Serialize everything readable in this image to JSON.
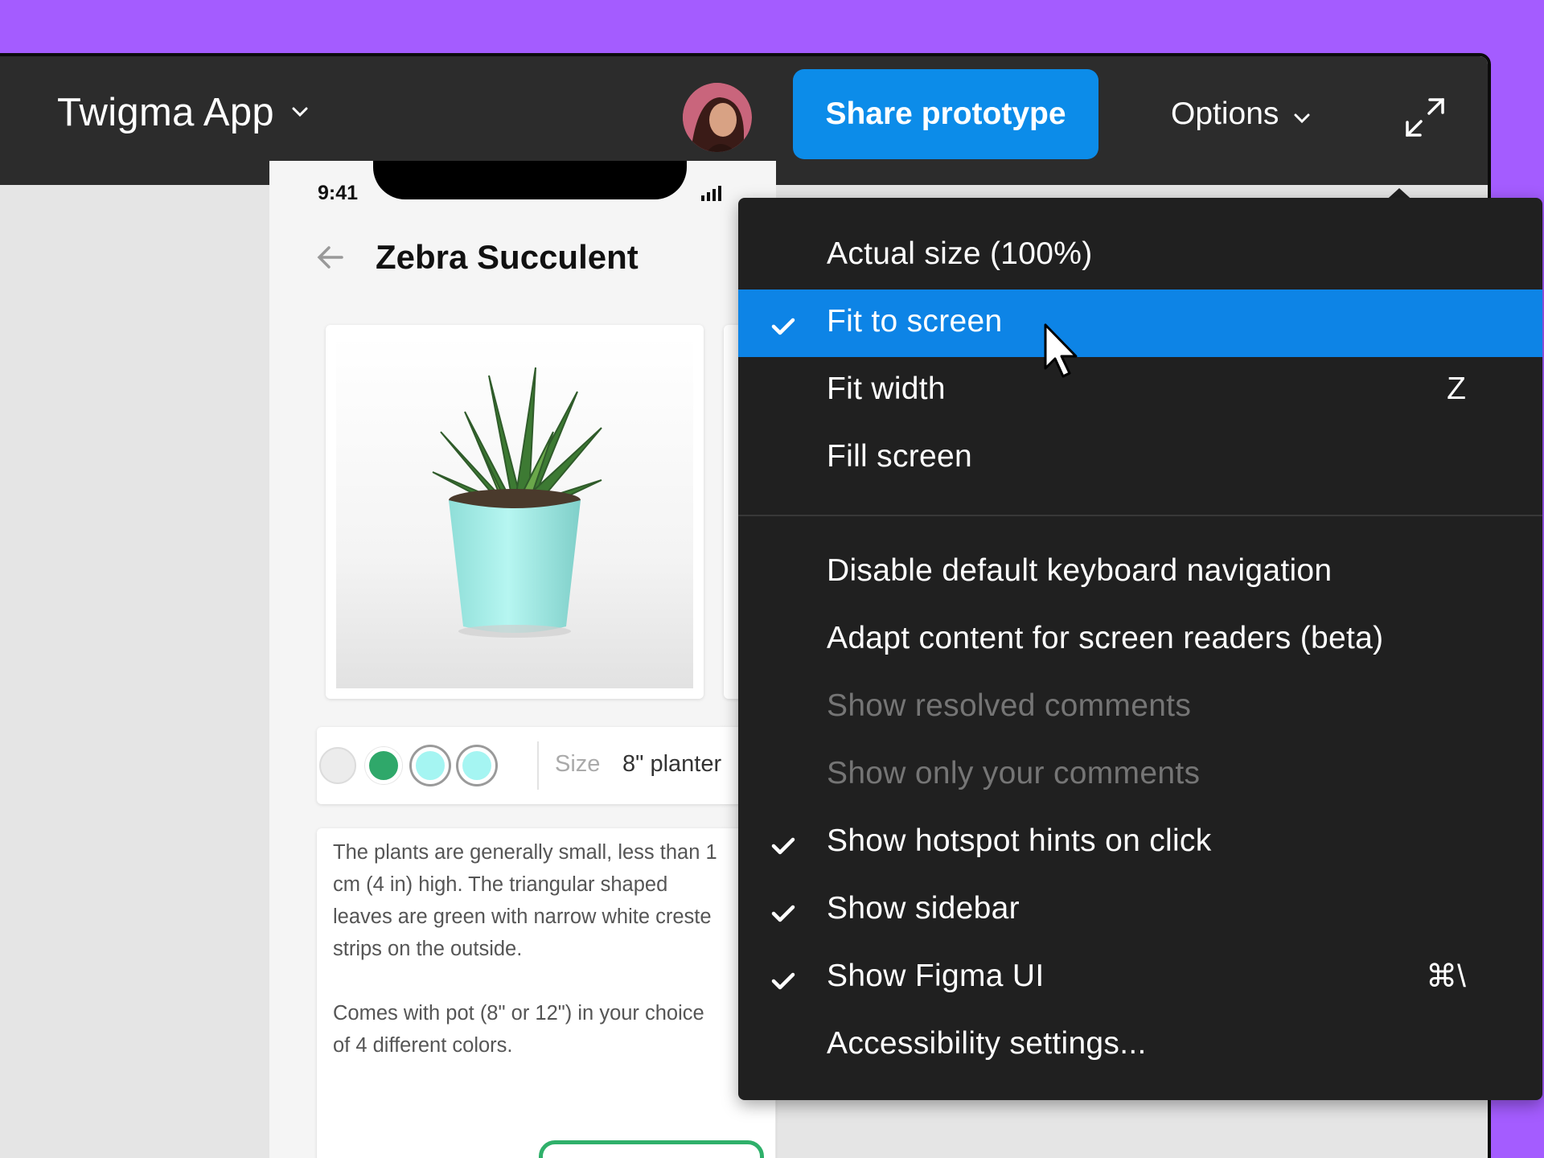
{
  "header": {
    "app_title": "Twigma App",
    "share_label": "Share prototype",
    "options_label": "Options"
  },
  "prototype": {
    "status_time": "9:41",
    "product_title": "Zebra Succulent",
    "size_label": "Size",
    "size_value": "8\" planter",
    "swatches": [
      "#e8e8e8",
      "#2fa86a",
      "#a5f5f2",
      "#a5f5f2"
    ],
    "description": "The plants are generally small, less than 1\ncm (4 in) high. The triangular shaped\nleaves are green with narrow white creste\nstrips on the outside.\n\nComes with pot (8\" or 12\") in your choice\nof 4 different colors."
  },
  "menu": {
    "zoom_items": [
      {
        "label": "Actual size (100%)",
        "checked": false,
        "selected": false,
        "shortcut": ""
      },
      {
        "label": "Fit to screen",
        "checked": true,
        "selected": true,
        "shortcut": ""
      },
      {
        "label": "Fit width",
        "checked": false,
        "selected": false,
        "shortcut": "Z"
      },
      {
        "label": "Fill screen",
        "checked": false,
        "selected": false,
        "shortcut": ""
      }
    ],
    "settings_items": [
      {
        "label": "Disable default keyboard navigation",
        "checked": false,
        "disabled": false,
        "shortcut": ""
      },
      {
        "label": "Adapt content for screen readers (beta)",
        "checked": false,
        "disabled": false,
        "shortcut": ""
      },
      {
        "label": "Show resolved comments",
        "checked": false,
        "disabled": true,
        "shortcut": ""
      },
      {
        "label": "Show only your comments",
        "checked": false,
        "disabled": true,
        "shortcut": ""
      },
      {
        "label": "Show hotspot hints on click",
        "checked": true,
        "disabled": false,
        "shortcut": ""
      },
      {
        "label": "Show sidebar",
        "checked": true,
        "disabled": false,
        "shortcut": ""
      },
      {
        "label": "Show Figma UI",
        "checked": true,
        "disabled": false,
        "shortcut": "⌘\\"
      },
      {
        "label": "Accessibility settings...",
        "checked": false,
        "disabled": false,
        "shortcut": ""
      }
    ]
  },
  "colors": {
    "background": "#a45cff",
    "accent": "#0c8ce9",
    "menu_bg": "#202020",
    "selected_row": "#0d84e6"
  }
}
